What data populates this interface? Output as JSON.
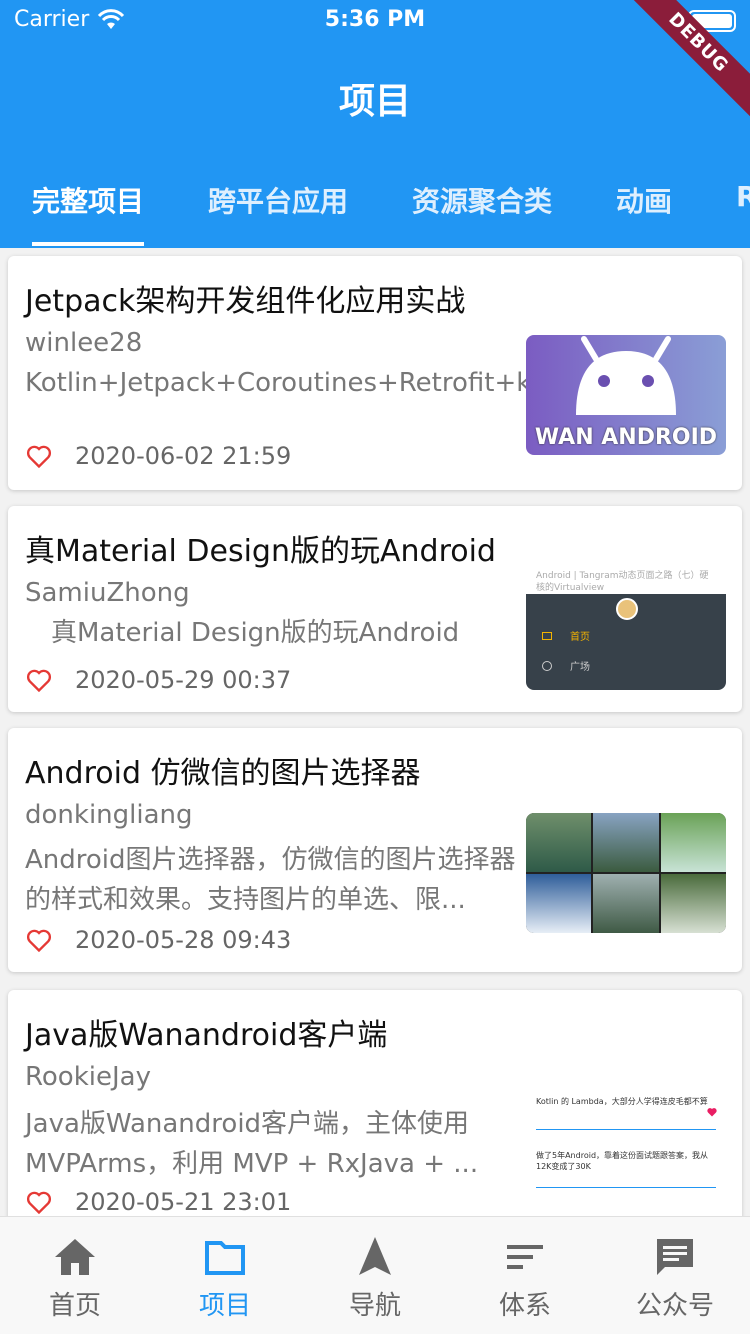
{
  "status_bar": {
    "carrier": "Carrier",
    "time": "5:36 PM"
  },
  "debug_banner": "DEBUG",
  "app_title": "项目",
  "tabs": [
    {
      "label": "完整项目",
      "active": true
    },
    {
      "label": "跨平台应用",
      "active": false
    },
    {
      "label": "资源聚合类",
      "active": false
    },
    {
      "label": "动画",
      "active": false
    },
    {
      "label": "R",
      "active": false
    }
  ],
  "projects": [
    {
      "title": "Jetpack架构开发组件化应用实战",
      "author": "winlee28",
      "desc": "Kotlin+Jetpack+Coroutines+Retrofit+koin",
      "date": "2020-06-02 21:59",
      "thumb_text": "WAN ANDROID"
    },
    {
      "title": "真Material Design版的玩Android",
      "author": "SamiuZhong",
      "desc": "　真Material Design版的玩Android",
      "date": "2020-05-29 00:37",
      "thumb_text": "Android | Tangram动态页面之路（七）硬核的Virtualview",
      "thumb_menu": [
        "首页",
        "广场"
      ]
    },
    {
      "title": "Android 仿微信的图片选择器",
      "author": "donkingliang",
      "desc": "Android图片选择器，仿微信的图片选择器的样式和效果。支持图片的单选、限...",
      "date": "2020-05-28 09:43"
    },
    {
      "title": "Java版Wanandroid客户端",
      "author": "RookieJay",
      "desc": "Java版Wanandroid客户端，主体使用MVPArms，利用 MVP + RxJava + ...",
      "date": "2020-05-21 23:01",
      "thumb_lines": [
        "Kotlin 的 Lambda，大部分人学得连皮毛都不算",
        "做了5年Android，靠着这份面试题跟答案，我从12K变成了30K"
      ]
    }
  ],
  "bottom_nav": [
    {
      "label": "首页",
      "icon": "home-icon",
      "active": false
    },
    {
      "label": "项目",
      "icon": "folder-icon",
      "active": true
    },
    {
      "label": "导航",
      "icon": "navigation-icon",
      "active": false
    },
    {
      "label": "体系",
      "icon": "sort-icon",
      "active": false
    },
    {
      "label": "公众号",
      "icon": "chat-icon",
      "active": false
    }
  ],
  "colors": {
    "primary": "#2196f3",
    "heart": "#e53935",
    "debug": "#8b1d3a"
  }
}
